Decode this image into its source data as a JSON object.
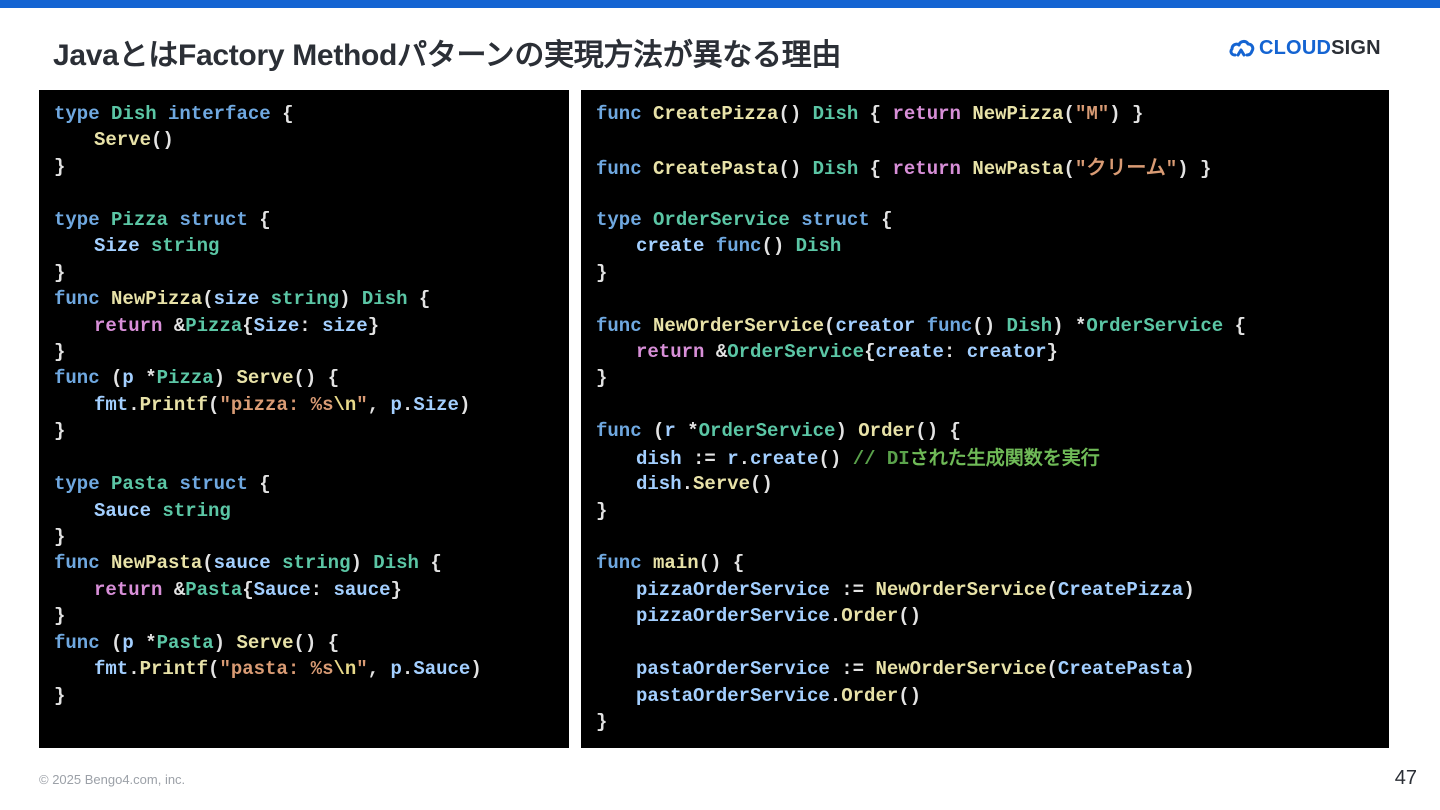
{
  "slide": {
    "title": "JavaとはFactory Methodパターンの実現方法が異なる理由",
    "footer": "© 2025 Bengo4.com, inc.",
    "page_number": "47",
    "accent_color": "#1464d2"
  },
  "logo": {
    "icon": "cloud-icon",
    "text_accent": "CLOUD",
    "text_main": "SIGN"
  },
  "code_left": {
    "l1": {
      "a": "type",
      "b": "Dish",
      "c": "interface",
      "d": "{"
    },
    "l2": {
      "a": "Serve",
      "b": "()"
    },
    "l3": {
      "a": "}"
    },
    "l5": {
      "a": "type",
      "b": "Pizza",
      "c": "struct",
      "d": "{"
    },
    "l6": {
      "a": "Size",
      "b": "string"
    },
    "l7": {
      "a": "}"
    },
    "l8": {
      "a": "func",
      "b": "NewPizza",
      "c": "(",
      "d": "size",
      "e": "string",
      "f": ")",
      "g": "Dish",
      "h": "{"
    },
    "l9": {
      "a": "return",
      "b": "&",
      "c": "Pizza",
      "d": "{",
      "e": "Size",
      "f": ":",
      "g": "size",
      "h": "}"
    },
    "l10": {
      "a": "}"
    },
    "l11": {
      "a": "func",
      "b": "(",
      "c": "p",
      "d": "*",
      "e": "Pizza",
      "f": ")",
      "g": "Serve",
      "h": "()",
      "i": "{"
    },
    "l12": {
      "a": "fmt",
      "b": ".",
      "c": "Printf",
      "d": "(",
      "e": "\"pizza: %s",
      "f": "\\n",
      "g": "\"",
      "h": ",",
      "i": "p",
      "j": ".",
      "k": "Size",
      "l": ")"
    },
    "l13": {
      "a": "}"
    },
    "l15": {
      "a": "type",
      "b": "Pasta",
      "c": "struct",
      "d": "{"
    },
    "l16": {
      "a": "Sauce",
      "b": "string"
    },
    "l17": {
      "a": "}"
    },
    "l18": {
      "a": "func",
      "b": "NewPasta",
      "c": "(",
      "d": "sauce",
      "e": "string",
      "f": ")",
      "g": "Dish",
      "h": "{"
    },
    "l19": {
      "a": "return",
      "b": "&",
      "c": "Pasta",
      "d": "{",
      "e": "Sauce",
      "f": ":",
      "g": "sauce",
      "h": "}"
    },
    "l20": {
      "a": "}"
    },
    "l21": {
      "a": "func",
      "b": "(",
      "c": "p",
      "d": "*",
      "e": "Pasta",
      "f": ")",
      "g": "Serve",
      "h": "()",
      "i": "{"
    },
    "l22": {
      "a": "fmt",
      "b": ".",
      "c": "Printf",
      "d": "(",
      "e": "\"pasta: %s",
      "f": "\\n",
      "g": "\"",
      "h": ",",
      "i": "p",
      "j": ".",
      "k": "Sauce",
      "l": ")"
    },
    "l23": {
      "a": "}"
    }
  },
  "code_right": {
    "r1": {
      "a": "func",
      "b": "CreatePizza",
      "c": "()",
      "d": "Dish",
      "e": "{",
      "f": "return",
      "g": "NewPizza",
      "h": "(",
      "i": "\"M\"",
      "j": ")",
      "k": "}"
    },
    "r3": {
      "a": "func",
      "b": "CreatePasta",
      "c": "()",
      "d": "Dish",
      "e": "{",
      "f": "return",
      "g": "NewPasta",
      "h": "(",
      "i": "\"",
      "j": "クリーム",
      "k": "\"",
      "l": ")",
      "m": "}"
    },
    "r5": {
      "a": "type",
      "b": "OrderService",
      "c": "struct",
      "d": "{"
    },
    "r6": {
      "a": "create",
      "b": "func",
      "c": "()",
      "d": "Dish"
    },
    "r7": {
      "a": "}"
    },
    "r9": {
      "a": "func",
      "b": "NewOrderService",
      "c": "(",
      "d": "creator",
      "e": "func",
      "f": "()",
      "g": "Dish",
      "h": ")",
      "i": "*",
      "j": "OrderService",
      "k": "{"
    },
    "r10": {
      "a": "return",
      "b": "&",
      "c": "OrderService",
      "d": "{",
      "e": "create",
      "f": ":",
      "g": "creator",
      "h": "}"
    },
    "r11": {
      "a": "}"
    },
    "r13": {
      "a": "func",
      "b": "(",
      "c": "r",
      "d": "*",
      "e": "OrderService",
      "f": ")",
      "g": "Order",
      "h": "()",
      "i": "{"
    },
    "r14": {
      "a": "dish",
      "b": ":=",
      "c": "r",
      "d": ".",
      "e": "create",
      "f": "()",
      "g": "// DI",
      "h": "された生成関数を実行"
    },
    "r15": {
      "a": "dish",
      "b": ".",
      "c": "Serve",
      "d": "()"
    },
    "r16": {
      "a": "}"
    },
    "r18": {
      "a": "func",
      "b": "main",
      "c": "()",
      "d": "{"
    },
    "r19": {
      "a": "pizzaOrderService",
      "b": ":=",
      "c": "NewOrderService",
      "d": "(",
      "e": "CreatePizza",
      "f": ")"
    },
    "r20": {
      "a": "pizzaOrderService",
      "b": ".",
      "c": "Order",
      "d": "()"
    },
    "r22": {
      "a": "pastaOrderService",
      "b": ":=",
      "c": "NewOrderService",
      "d": "(",
      "e": "CreatePasta",
      "f": ")"
    },
    "r23": {
      "a": "pastaOrderService",
      "b": ".",
      "c": "Order",
      "d": "()"
    },
    "r24": {
      "a": "}"
    }
  }
}
